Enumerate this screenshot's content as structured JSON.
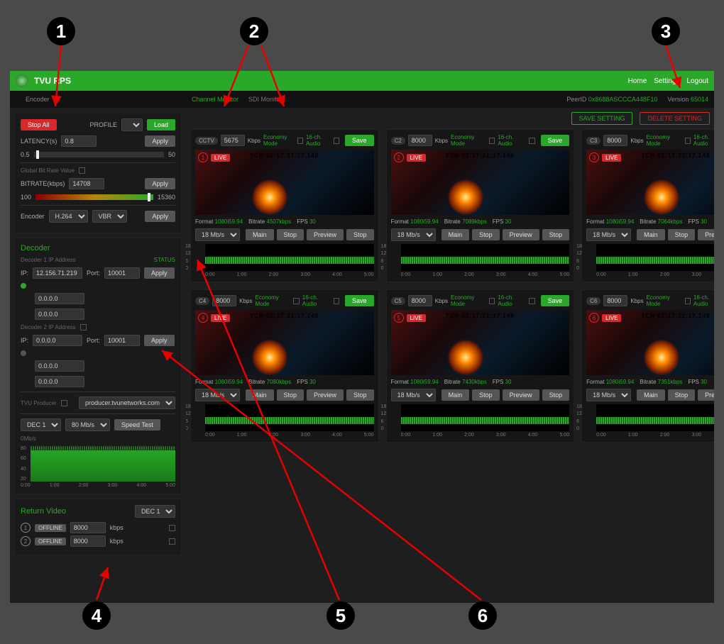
{
  "header": {
    "title": "TVU RPS",
    "home": "Home",
    "settings": "Settings",
    "logout": "Logout"
  },
  "subbar": {
    "encoder_label": "Encoder",
    "tab1": "Channel Monitor",
    "tab2": "SDI Monitor",
    "peerid_label": "PeerID",
    "peerid": "0x8688ASCCCA448F10",
    "version_label": "Version",
    "version": "65014"
  },
  "encoder": {
    "stop_all": "Stop All",
    "profile_label": "PROFILE",
    "load": "Load",
    "latency_label": "LATENCY(s)",
    "latency_val": "0.8",
    "apply": "Apply",
    "lat_min": "0.5",
    "lat_max": "50",
    "global_label": "Global Bit Rate Value",
    "bitrate_label": "BITRATE(kbps)",
    "bitrate_val": "14708",
    "br_min": "100",
    "br_max": "15360",
    "enc_label": "Encoder",
    "codec": "H.264",
    "mode": "VBR"
  },
  "decoder": {
    "title": "Decoder",
    "d1_label": "Decoder 1 IP Address",
    "status_label": "STATUS",
    "ip_label": "IP:",
    "port_label": "Port:",
    "d1_ip": "12.156.71.219",
    "d1_port": "10001",
    "zero": "0.0.0.0",
    "d2_label": "Decoder 2 IP Address",
    "d2_ip": "0.0.0.0",
    "d2_port": "10001",
    "producer_label": "TVU Producer",
    "producer_host": "producer.tvunetworks.com",
    "dec_sel": "DEC 1",
    "speed": "80 Mb/s",
    "speedtest": "Speed Test",
    "sp_val": "0Mb/s",
    "y80": "80",
    "y60": "60",
    "y40": "40",
    "y20": "20",
    "x0": "0:00",
    "x1": "1:00",
    "x2": "2:00",
    "x3": "3:00",
    "x4": "4:00",
    "x5": "5:00"
  },
  "return": {
    "title": "Return Video",
    "dec": "DEC 1",
    "offline": "OFFLINE",
    "kbps": "kbps",
    "r1_br": "8000",
    "r2_br": "8000",
    "n1": "1",
    "n2": "2"
  },
  "main": {
    "save_setting": "SAVE SETTING",
    "delete_setting": "DELETE SETTING",
    "kbps": "Kbps",
    "economy": "Economy Mode",
    "audio16": "16-ch. Audio",
    "save": "Save",
    "live": "LIVE",
    "tc": "TCR 02:17:21:17.148",
    "format_label": "Format",
    "format": "1080i59.94",
    "bitrate_label": "Bitrate",
    "fps_label": "FPS",
    "fps": "30",
    "rate_sel": "18 Mb/s",
    "main_btn": "Main",
    "stop_btn": "Stop",
    "preview_btn": "Preview",
    "y18": "18",
    "y12": "12",
    "y6": "6",
    "y0": "0",
    "x0": "0:00",
    "x1": "1:00",
    "x2": "2:00",
    "x3": "3:00",
    "x4": "4:00",
    "x5": "5:00",
    "cards": [
      {
        "id": "CCTV",
        "br": "5675",
        "bitrate": "4507kbps",
        "n": "1"
      },
      {
        "id": "C2",
        "br": "8000",
        "bitrate": "7089kbps",
        "n": "2"
      },
      {
        "id": "C3",
        "br": "8000",
        "bitrate": "7064kbps",
        "n": "3"
      },
      {
        "id": "C4",
        "br": "8000",
        "bitrate": "7080kbps",
        "n": "4"
      },
      {
        "id": "C5",
        "br": "8000",
        "bitrate": "7430kbps",
        "n": "5"
      },
      {
        "id": "C6",
        "br": "8000",
        "bitrate": "7351kbps",
        "n": "6"
      }
    ]
  },
  "badges": {
    "b1": "1",
    "b2": "2",
    "b3": "3",
    "b4": "4",
    "b5": "5",
    "b6": "6"
  }
}
